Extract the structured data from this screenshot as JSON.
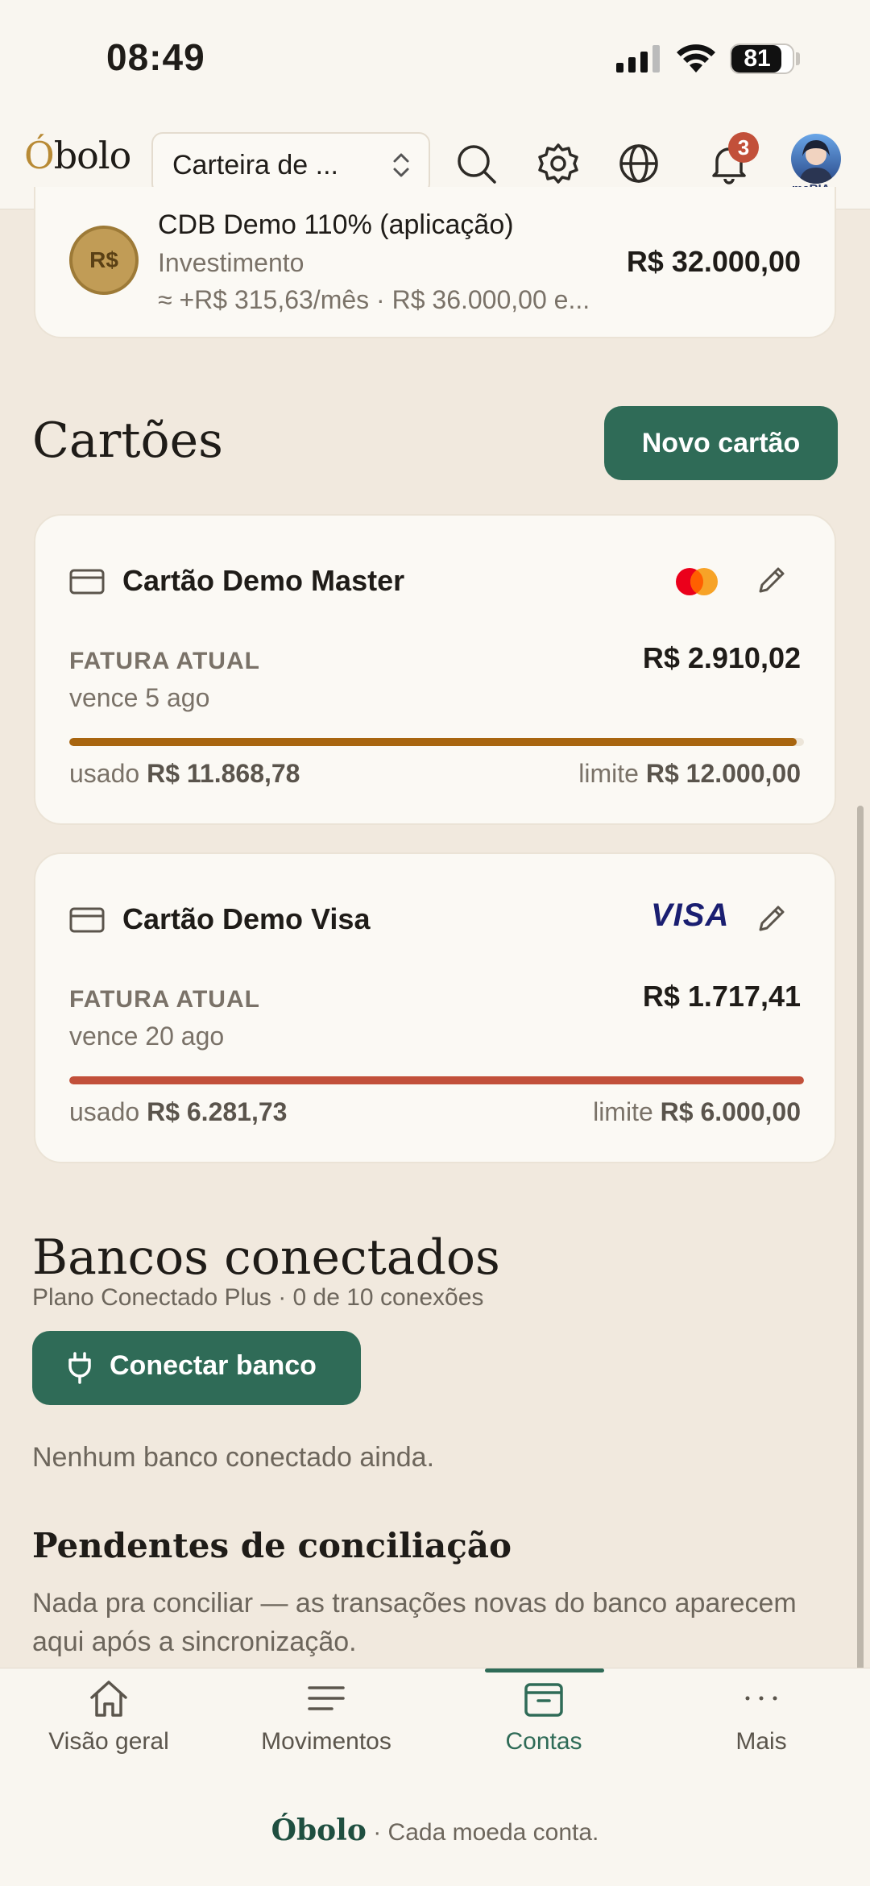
{
  "status": {
    "time": "08:49",
    "battery": "81"
  },
  "header": {
    "logo_accent": "Ó",
    "logo_rest": "bolo",
    "wallet_select": "Carteira de ...",
    "notifications_count": "3",
    "avatar_text": "maRIA"
  },
  "investment": {
    "coin": "R$",
    "name": "CDB Demo 110% (aplicação)",
    "type": "Investimento",
    "estimate": "≈ +R$ 315,63/mês · R$ 36.000,00 e...",
    "value": "R$ 32.000,00"
  },
  "cards_section": {
    "title": "Cartões",
    "new_card_button": "Novo cartão",
    "cards": [
      {
        "name": "Cartão Demo Master",
        "brand": "mastercard",
        "invoice_label": "FATURA ATUAL",
        "due": "vence 5 ago",
        "amount": "R$ 2.910,02",
        "used_label": "usado",
        "used": "R$ 11.868,78",
        "limit_label": "limite",
        "limit": "R$ 12.000,00",
        "usage_fraction": 0.99,
        "bar_color": "#a8650f"
      },
      {
        "name": "Cartão Demo Visa",
        "brand": "visa",
        "brand_text": "VISA",
        "invoice_label": "FATURA ATUAL",
        "due": "vence 20 ago",
        "amount": "R$ 1.717,41",
        "used_label": "usado",
        "used": "R$ 6.281,73",
        "limit_label": "limite",
        "limit": "R$ 6.000,00",
        "usage_fraction": 1.0,
        "bar_color": "#c2503a"
      }
    ]
  },
  "banks_section": {
    "title": "Bancos conectados",
    "subtitle": "Plano Conectado Plus · 0 de 10 conexões",
    "connect_button": "Conectar banco",
    "empty_text": "Nenhum banco conectado ainda."
  },
  "pending_section": {
    "title": "Pendentes de conciliação",
    "text": "Nada pra conciliar — as transações novas do banco aparecem aqui após a sincronização."
  },
  "tabbar": {
    "tabs": [
      {
        "label": "Visão geral",
        "icon": "home-icon"
      },
      {
        "label": "Movimentos",
        "icon": "list-icon"
      },
      {
        "label": "Contas",
        "icon": "wallet-icon",
        "active": true
      },
      {
        "label": "Mais",
        "icon": "more-icon"
      }
    ],
    "footer_brand": "Óbolo",
    "footer_tagline": "· Cada moeda conta."
  },
  "colors": {
    "accent": "#2f6b57",
    "background": "#f1e9de",
    "card": "#fbf9f4",
    "badge": "#c2503a"
  }
}
